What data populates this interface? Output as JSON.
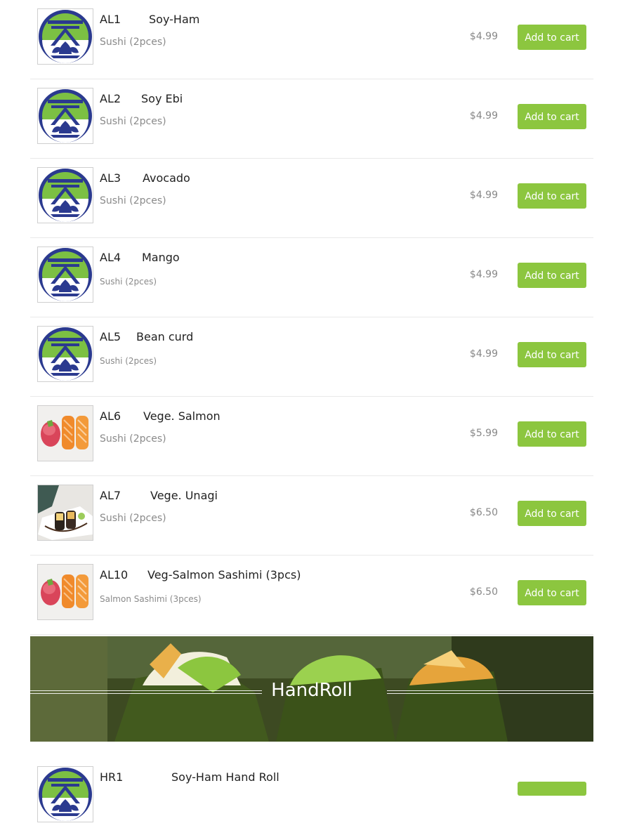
{
  "menu_items": [
    {
      "code": "AL1",
      "name": "Soy-Ham",
      "desc": "Sushi (2pces)",
      "price": "$4.99",
      "button": "Add to cart",
      "image": "logo-icon"
    },
    {
      "code": "AL2",
      "name": "Soy Ebi",
      "desc": "Sushi (2pces)",
      "price": "$4.99",
      "button": "Add to cart",
      "image": "logo-icon"
    },
    {
      "code": "AL3",
      "name": "Avocado",
      "desc": "Sushi (2pces)",
      "price": "$4.99",
      "button": "Add to cart",
      "image": "logo-icon"
    },
    {
      "code": "AL4",
      "name": "Mango",
      "desc": "Sushi (2pces)",
      "price": "$4.99",
      "button": "Add to cart",
      "image": "logo-icon"
    },
    {
      "code": "AL5",
      "name": "Bean curd",
      "desc": "Sushi (2pces)",
      "price": "$4.99",
      "button": "Add to cart",
      "image": "logo-icon"
    },
    {
      "code": "AL6",
      "name": "Vege. Salmon",
      "desc": "Sushi (2pces)",
      "price": "$5.99",
      "button": "Add to cart",
      "image": "salmon-sushi-photo"
    },
    {
      "code": "AL7",
      "name": "Vege. Unagi",
      "desc": "Sushi (2pces)",
      "price": "$6.50",
      "button": "Add to cart",
      "image": "unagi-sushi-photo"
    },
    {
      "code": "AL10",
      "name": "Veg-Salmon Sashimi (3pcs)",
      "desc": "Salmon Sashimi (3pces)",
      "price": "$6.50",
      "button": "Add to cart",
      "image": "salmon-sushi-photo"
    }
  ],
  "category_banner": {
    "title": "HandRoll"
  },
  "next_item": {
    "code": "HR1",
    "name": "Soy-Ham Hand Roll"
  },
  "colors": {
    "accent": "#8cc63f",
    "logo_blue": "#2b3a8f",
    "logo_green": "#7cc043"
  }
}
